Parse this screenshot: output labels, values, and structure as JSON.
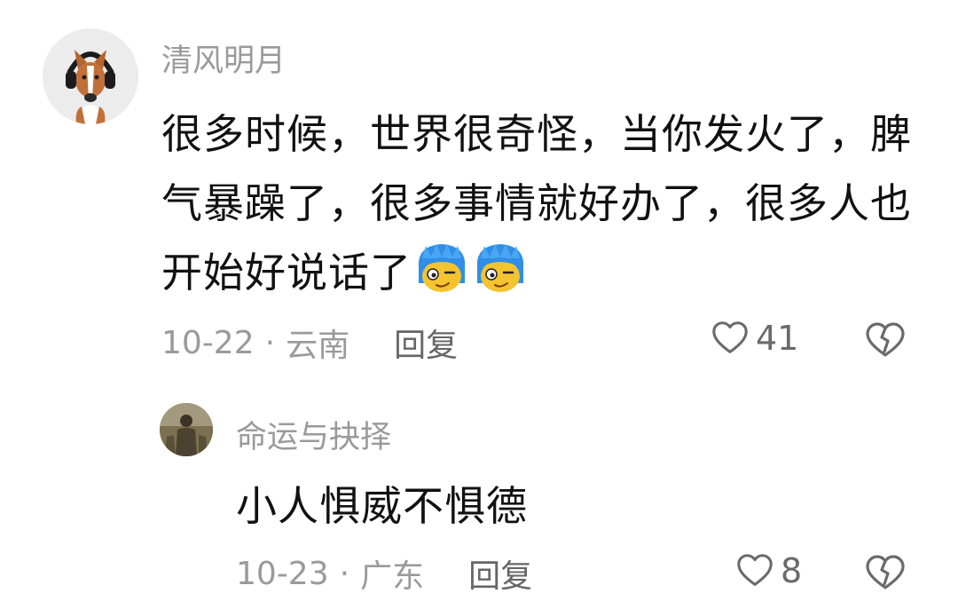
{
  "comments": [
    {
      "username": "清风明月",
      "text": "很多时候，世界很奇怪，当你发火了，脾气暴躁了，很多事情就好办了，很多人也开始好说话了",
      "emojis": [
        "blue-hair-face-emoji",
        "blue-hair-face-emoji"
      ],
      "date": "10-22",
      "location": "云南",
      "reply_label": "回复",
      "like_count": "41",
      "dislike_icon": "broken-heart-icon"
    },
    {
      "username": "命运与抉择",
      "text": "小人惧威不惧德",
      "date": "10-23",
      "location": "广东",
      "reply_label": "回复",
      "like_count": "8",
      "dislike_icon": "broken-heart-icon"
    }
  ],
  "separator": "·",
  "colors": {
    "meta": "#9a9a9a",
    "text": "#111111",
    "emoji_hair": "#2f8fe8",
    "emoji_face": "#f4c430"
  }
}
